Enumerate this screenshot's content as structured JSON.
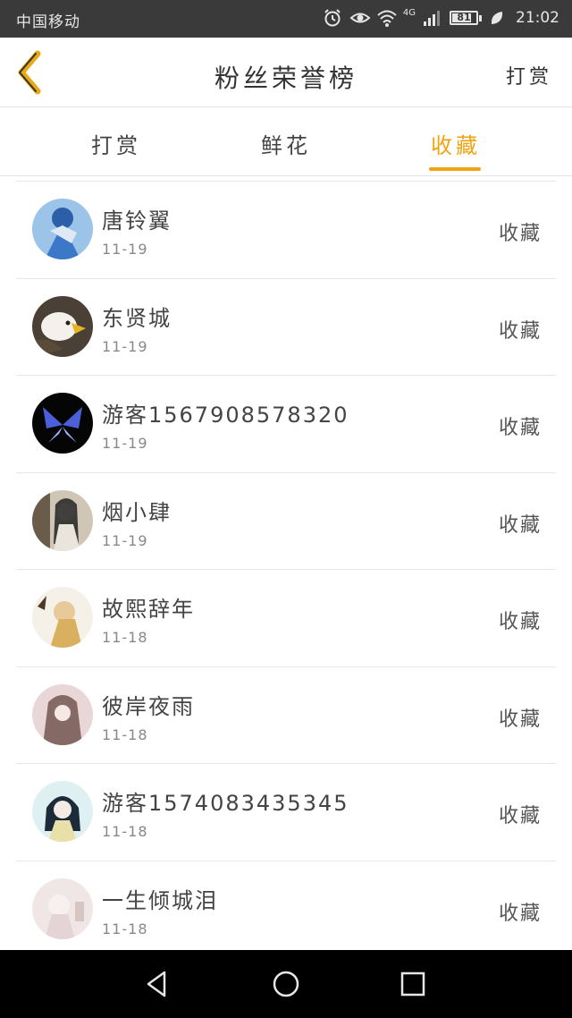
{
  "status_bar": {
    "carrier": "中国移动",
    "network": "4G",
    "battery": "81",
    "battery_level": 0.81,
    "time": "21:02"
  },
  "header": {
    "title": "粉丝荣誉榜",
    "action_label": "打赏"
  },
  "tabs": [
    {
      "label": "打赏",
      "active": false
    },
    {
      "label": "鲜花",
      "active": false
    },
    {
      "label": "收藏",
      "active": true
    }
  ],
  "colors": {
    "accent": "#f1a311",
    "status_bar_bg": "#3a3a3a",
    "nav_bar_bg": "#000000"
  },
  "fans": [
    {
      "name": "唐铃翼",
      "date": "11-19",
      "type": "收藏"
    },
    {
      "name": "东贤城",
      "date": "11-19",
      "type": "收藏"
    },
    {
      "name": "游客1567908578320",
      "date": "11-19",
      "type": "收藏"
    },
    {
      "name": "烟小肆",
      "date": "11-19",
      "type": "收藏"
    },
    {
      "name": "故熙辞年",
      "date": "11-18",
      "type": "收藏"
    },
    {
      "name": "彼岸夜雨",
      "date": "11-18",
      "type": "收藏"
    },
    {
      "name": "游客1574083435345",
      "date": "11-18",
      "type": "收藏"
    },
    {
      "name": "一生倾城泪",
      "date": "11-18",
      "type": "收藏"
    }
  ],
  "icons": {
    "back": "chevron-left-icon",
    "nav_back": "triangle-back-icon",
    "nav_home": "circle-home-icon",
    "nav_recent": "square-recent-icon"
  }
}
